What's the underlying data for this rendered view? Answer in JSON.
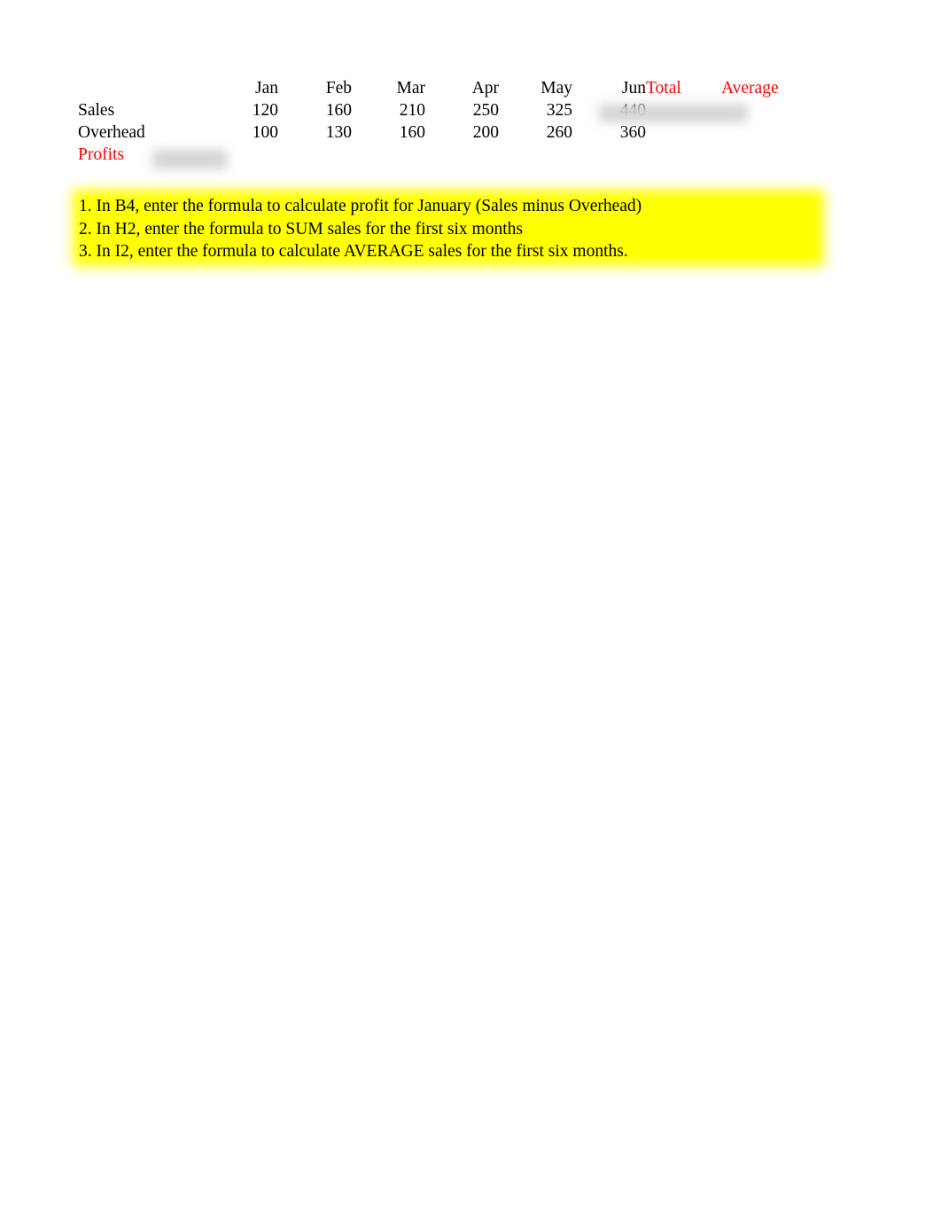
{
  "document": {
    "background_color": "#ffffff",
    "accent_color": "#ff0000",
    "highlight_color": "#ffff00"
  },
  "table": {
    "corner_label": "",
    "column_headers": [
      "Jan",
      "Feb",
      "Mar",
      "Apr",
      "May",
      "Jun"
    ],
    "summary_headers": [
      "Total",
      "Average"
    ],
    "rows": [
      {
        "label": "Sales",
        "label_color": "#000000",
        "values": [
          "120",
          "160",
          "210",
          "250",
          "325",
          "440"
        ],
        "total": "",
        "average": ""
      },
      {
        "label": "Overhead",
        "label_color": "#000000",
        "values": [
          "100",
          "130",
          "160",
          "200",
          "260",
          "360"
        ],
        "total": "",
        "average": ""
      },
      {
        "label": "Profits",
        "label_color": "#ff0000",
        "values": [
          "",
          "",
          "",
          "",
          "",
          ""
        ],
        "total": "",
        "average": ""
      }
    ]
  },
  "instructions": {
    "lines": [
      "1. In B4, enter the formula to calculate profit for January (Sales minus Overhead)",
      "2. In H2, enter the formula to SUM sales for the first six months",
      "3. In I2, enter the formula to calculate AVERAGE sales for the first six months."
    ]
  }
}
